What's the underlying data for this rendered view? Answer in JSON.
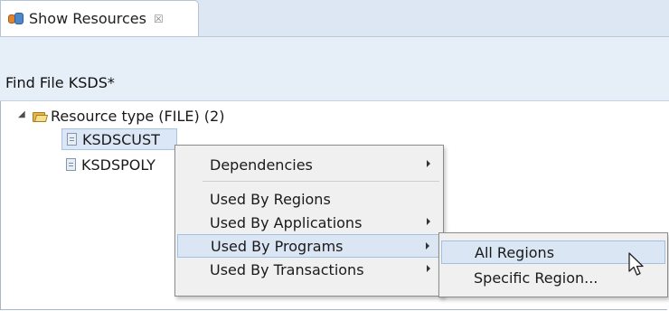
{
  "tab": {
    "title": "Show Resources",
    "close_glyph": "☒",
    "icon": "resources-icon"
  },
  "header": {
    "title": "Find File KSDS*"
  },
  "tree": {
    "root": {
      "label": "Resource type (FILE)  (2)",
      "expanded": true
    },
    "items": [
      {
        "label": "KSDSCUST",
        "selected": true
      },
      {
        "label": "KSDSPOLY",
        "selected": false
      }
    ]
  },
  "context_menu": {
    "items": [
      {
        "label": "Dependencies",
        "submenu": true
      },
      {
        "label": "Used By Regions",
        "submenu": false
      },
      {
        "label": "Used By Applications",
        "submenu": true
      },
      {
        "label": "Used By Programs",
        "submenu": true,
        "highlighted": true
      },
      {
        "label": "Used By Transactions",
        "submenu": true
      }
    ]
  },
  "submenu": {
    "items": [
      {
        "label": "All Regions",
        "highlighted": true
      },
      {
        "label": "Specific Region..."
      }
    ]
  },
  "colors": {
    "selection": "#dbe6f4",
    "header_band": "#e6eef8",
    "tab_strip": "#dde7f3"
  }
}
